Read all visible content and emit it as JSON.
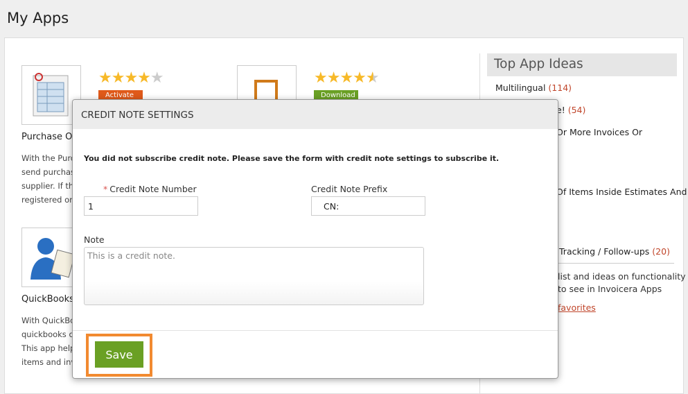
{
  "page": {
    "title": "My Apps"
  },
  "apps": [
    {
      "name": "Purchase Or",
      "rating": 4,
      "button_label": "Activate",
      "button_color": "#e05a1a",
      "description": [
        "With the Purc",
        "send purchas",
        "supplier. If th",
        "registered on"
      ]
    },
    {
      "name": "",
      "rating": 4.5,
      "button_label": "Download",
      "button_color": "#6aa024",
      "description": []
    },
    {
      "name": "QuickBooks",
      "rating": 0,
      "button_label": "",
      "button_color": "",
      "description": [
        "With QuickBo",
        "quickbooks o",
        "This app help",
        "items and inv"
      ]
    }
  ],
  "sidebar": {
    "header": "Top App Ideas",
    "ideas": [
      {
        "label": "Multilingual",
        "count": "(114)"
      },
      {
        "label": "e!",
        "count": "(54)"
      },
      {
        "label": "Or More Invoices Or",
        "count": ""
      },
      {
        "label": "Of Items Inside Estimates And",
        "count": ""
      },
      {
        "label": "Tracking / Follow-ups",
        "count": "(20)"
      }
    ],
    "text_line1": "list and ideas on functionality",
    "text_line2": "to see in Invoicera Apps",
    "link": "favorites"
  },
  "modal": {
    "title": "CREDIT NOTE SETTINGS",
    "message": "You did not subscribe credit note. Please save the form with credit note settings to subscribe it.",
    "credit_note_number": {
      "label": "Credit Note Number",
      "value": "1"
    },
    "credit_note_prefix": {
      "label": "Credit Note Prefix",
      "value": "CN:"
    },
    "note": {
      "label": "Note",
      "placeholder": "This is a credit note."
    },
    "save_label": "Save"
  },
  "colors": {
    "accent_orange": "#f28a30",
    "save_green": "#6aa024",
    "count_red": "#c0452a",
    "star": "#f7b928"
  }
}
